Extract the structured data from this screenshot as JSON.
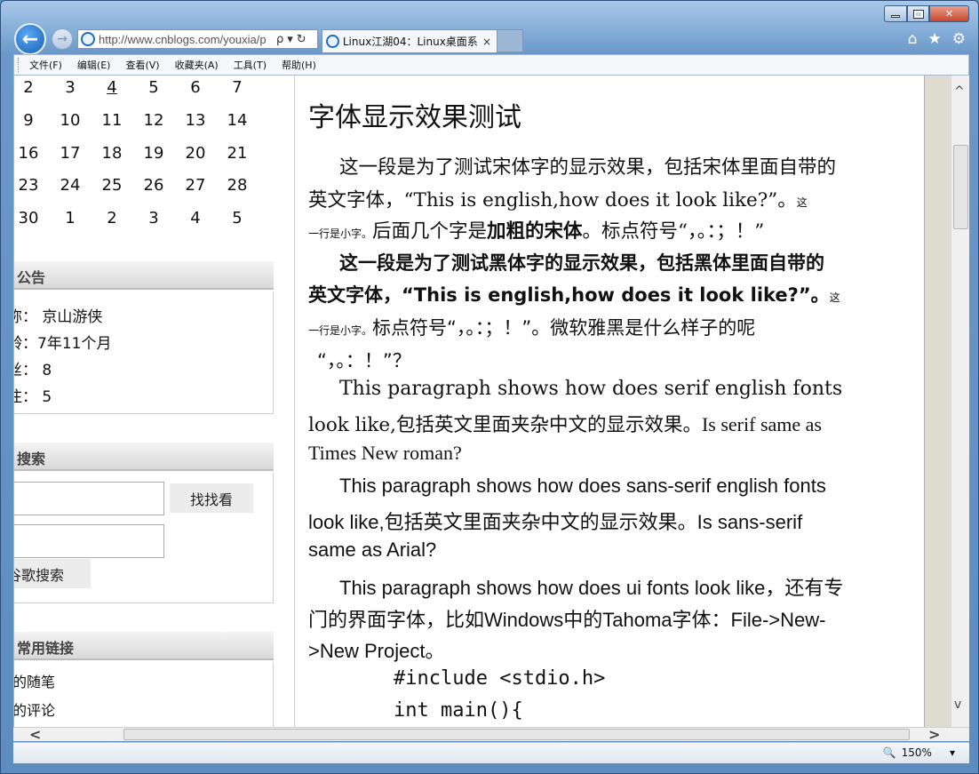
{
  "browser": {
    "address": "http://www.cnblogs.com/youxia/p",
    "tab_title": "Linux江湖04：Linux桌面系...",
    "menu": [
      "文件(F)",
      "编辑(E)",
      "查看(V)",
      "收藏夹(A)",
      "工具(T)",
      "帮助(H)"
    ],
    "zoom": "150%",
    "nav_back": "←",
    "nav_forward": "→",
    "addr_search": "ρ",
    "addr_dropdown": "▾",
    "addr_refresh": "↻",
    "tab_close": "×",
    "home_icon": "⌂",
    "favorites_icon": "★",
    "tools_icon": "⚙",
    "scroll_up": "^",
    "scroll_down": "v",
    "scroll_left": "<",
    "scroll_right": ">",
    "zoom_icon": "🔍",
    "zoom_dropdown": "▾"
  },
  "calendar": {
    "rows": [
      [
        "2",
        "3",
        "4",
        "5",
        "6",
        "7"
      ],
      [
        "9",
        "10",
        "11",
        "12",
        "13",
        "14"
      ],
      [
        "16",
        "17",
        "18",
        "19",
        "20",
        "21"
      ],
      [
        "23",
        "24",
        "25",
        "26",
        "27",
        "28"
      ],
      [
        "30",
        "1",
        "2",
        "3",
        "4",
        "5"
      ]
    ]
  },
  "notice": {
    "title": "公告",
    "lines": [
      "称：  京山游侠",
      "龄：7年11个月",
      "丝：  8",
      "注：  5"
    ]
  },
  "search": {
    "title": "搜索",
    "button1": "找找看",
    "button2": "谷歌搜索"
  },
  "links": {
    "title": "常用链接",
    "items": [
      "的随笔",
      "的评论"
    ]
  },
  "article": {
    "title": "字体显示效果测试",
    "p1": [
      "这一段是为了测试宋体字的显示效果，包括宋体里面自带的",
      "英文字体，“This is english,how does it look like?”。",
      "这",
      "一行是小字。",
      "后面几个字是",
      "加粗的宋体",
      "。标点符号“，。：；！”"
    ],
    "p2": [
      "这一段是为了测试黑体字的显示效果，包括黑体里面自带的",
      "英文字体，“This is english,how does it look like?”。",
      "这",
      "一行是小字。",
      "标点符号“，。：；！”。微软雅黑是什么样子的呢",
      "“，。：！”？"
    ],
    "p3": [
      "This paragraph shows how does serif english fonts",
      "look like,包括英文里面夹杂中文的显示效果。",
      "Is serif same as",
      "Times New roman?"
    ],
    "p4": [
      "This paragraph shows how does sans-serif english fonts",
      "look like,包括英文里面夹杂中文的显示效果。Is sans-serif",
      "same as Arial?"
    ],
    "p5": [
      "This paragraph shows how does ui fonts look like，还有专",
      "门的界面字体，比如Windows中的Tahoma字体：File->New-",
      ">New Project。"
    ],
    "code": [
      "#include <stdio.h>",
      "int main(){"
    ]
  }
}
